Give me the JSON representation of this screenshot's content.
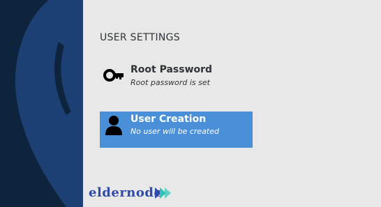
{
  "section": {
    "title": "USER SETTINGS"
  },
  "spokes": [
    {
      "title": "Root Password",
      "status": "Root password is set",
      "icon": "key-icon",
      "selected": false
    },
    {
      "title": "User Creation",
      "status": "No user will be created",
      "icon": "user-icon",
      "selected": true
    }
  ],
  "watermark": {
    "text": "eldernode"
  },
  "colors": {
    "sidebar": "#0e233c",
    "sidebar_accent": "#1c3f74",
    "selected_bg": "#4a90d9",
    "text": "#2e3436",
    "logo_blue": "#2f4aa8",
    "logo_accent": "#2ec4b6"
  }
}
